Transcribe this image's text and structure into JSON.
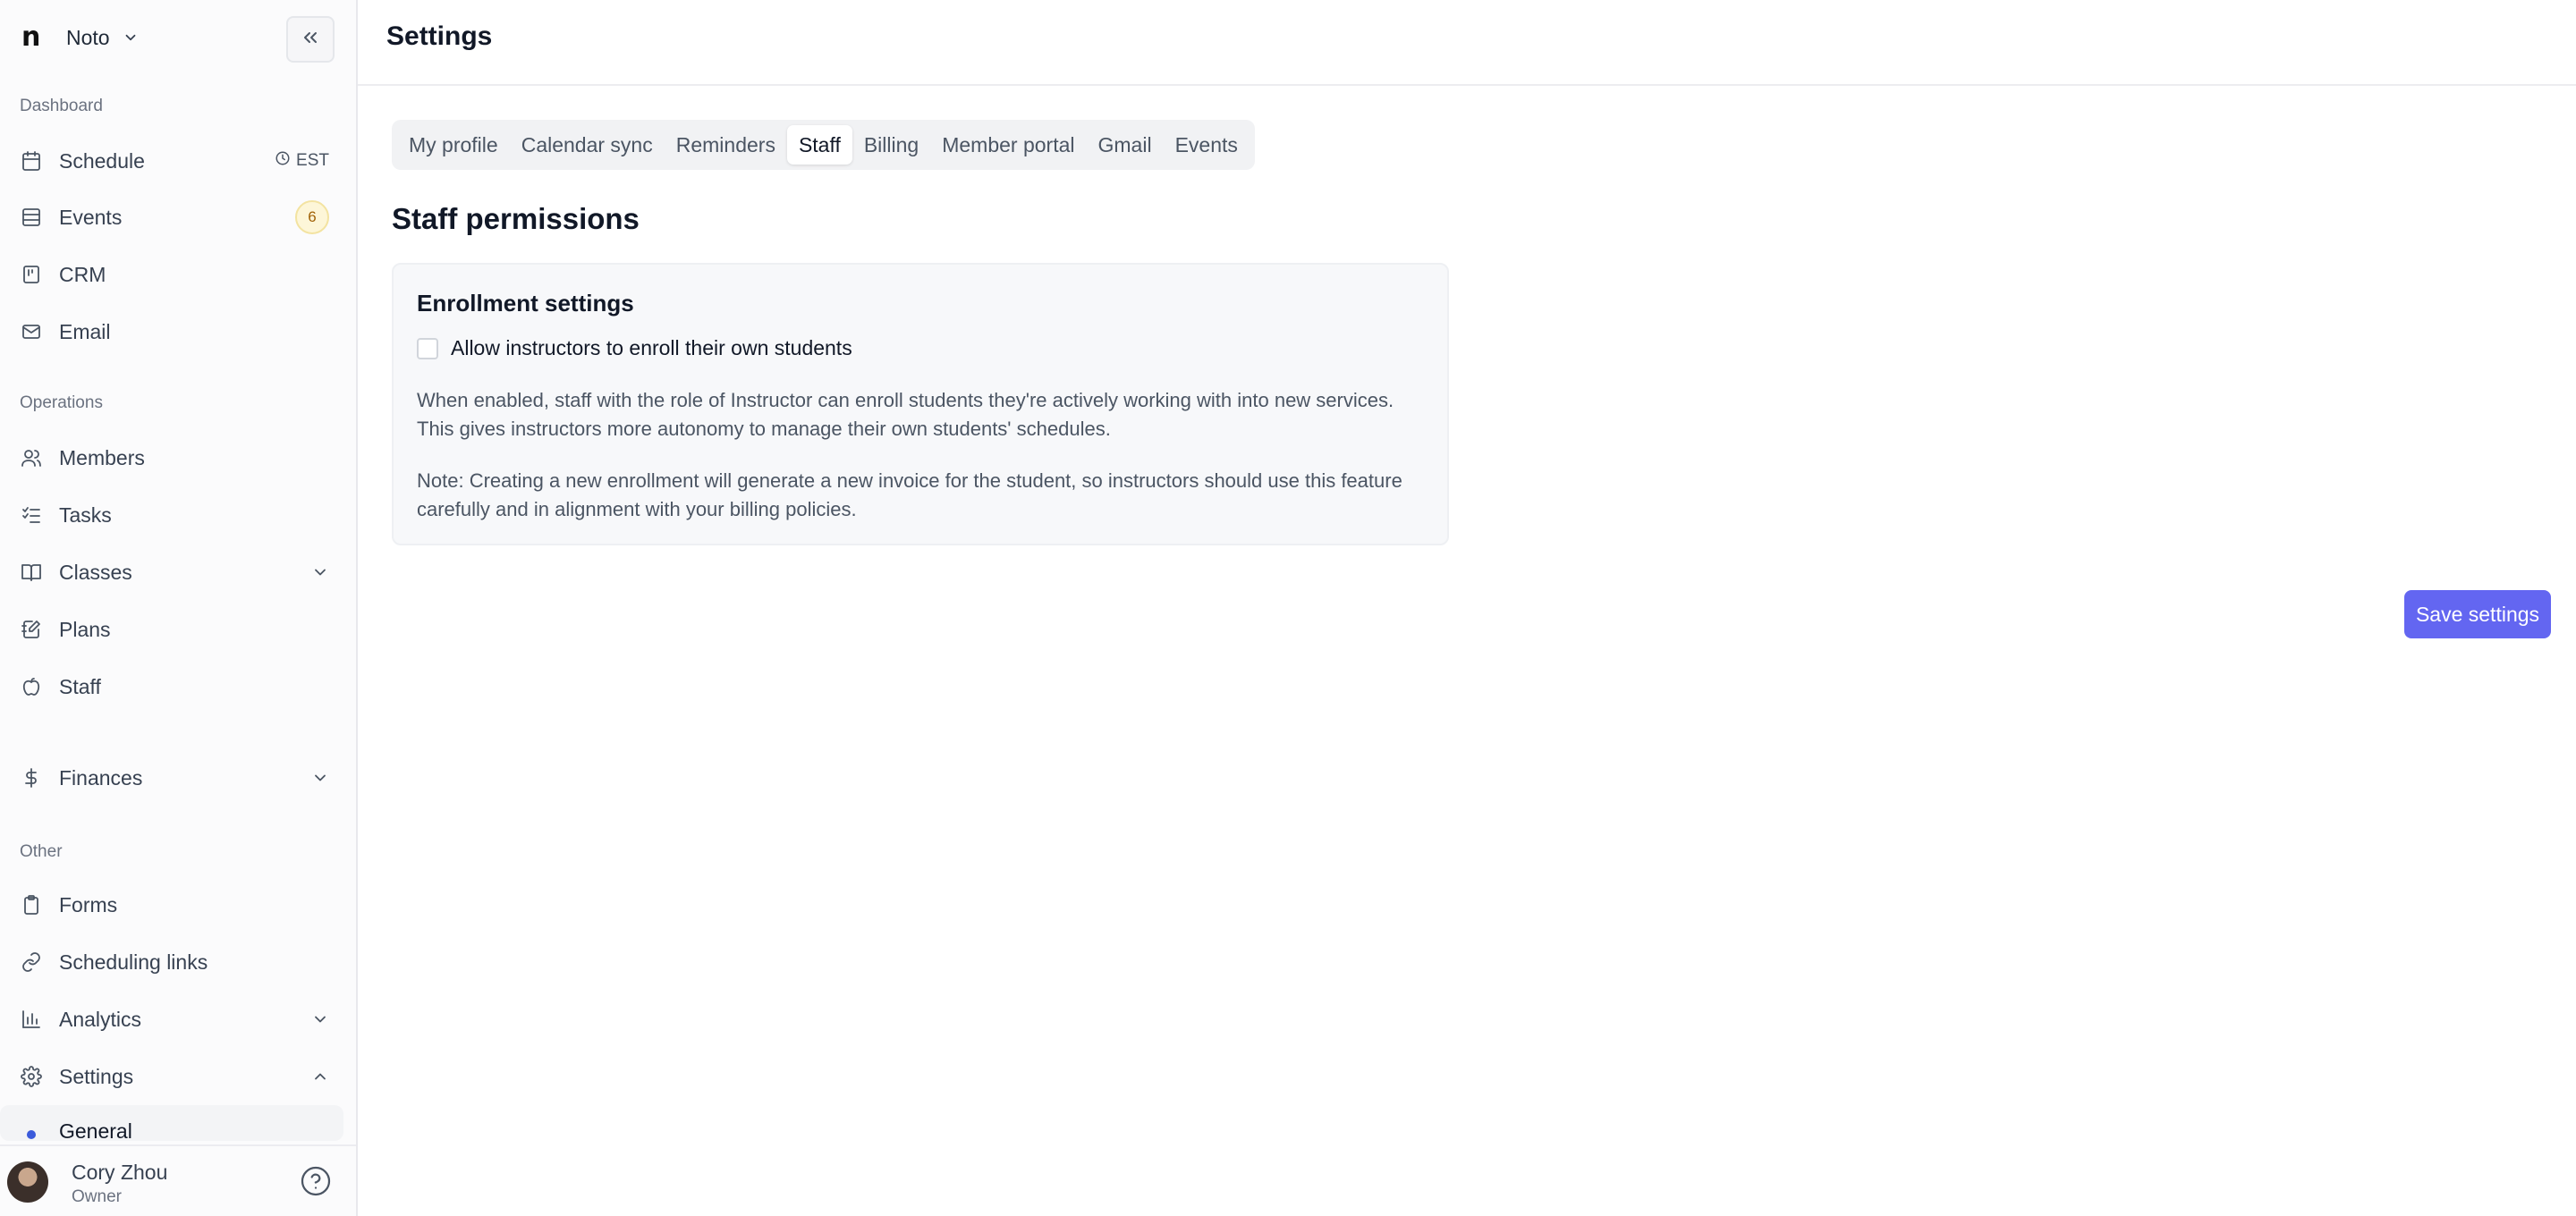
{
  "app": {
    "name": "Noto",
    "logo_text": "n"
  },
  "sidebar": {
    "sections": {
      "dashboard": "Dashboard",
      "operations": "Operations",
      "other": "Other"
    },
    "items": {
      "schedule": {
        "label": "Schedule",
        "timezone": "EST"
      },
      "events": {
        "label": "Events",
        "badge": "6"
      },
      "crm": {
        "label": "CRM"
      },
      "email": {
        "label": "Email"
      },
      "members": {
        "label": "Members"
      },
      "tasks": {
        "label": "Tasks"
      },
      "classes": {
        "label": "Classes"
      },
      "plans": {
        "label": "Plans"
      },
      "staff": {
        "label": "Staff"
      },
      "finances": {
        "label": "Finances"
      },
      "forms": {
        "label": "Forms"
      },
      "scheduling_links": {
        "label": "Scheduling links"
      },
      "analytics": {
        "label": "Analytics"
      },
      "settings": {
        "label": "Settings"
      }
    },
    "settings_subitem": "General",
    "user": {
      "name": "Cory Zhou",
      "role": "Owner"
    }
  },
  "header": {
    "title": "Settings"
  },
  "tabs": [
    {
      "label": "My profile"
    },
    {
      "label": "Calendar sync"
    },
    {
      "label": "Reminders"
    },
    {
      "label": "Staff",
      "active": true
    },
    {
      "label": "Billing"
    },
    {
      "label": "Member portal"
    },
    {
      "label": "Gmail"
    },
    {
      "label": "Events"
    }
  ],
  "main": {
    "section_title": "Staff permissions",
    "card": {
      "title": "Enrollment settings",
      "checkbox_label": "Allow instructors to enroll their own students",
      "checkbox_checked": false,
      "description": "When enabled, staff with the role of Instructor can enroll students they're actively working with into new services. This gives instructors more autonomy to manage their own students' schedules.",
      "note": "Note: Creating a new enrollment will generate a new invoice for the student, so instructors should use this feature carefully and in alignment with your billing policies."
    },
    "save_button": "Save settings"
  },
  "colors": {
    "accent": "#6366f1",
    "badge_bg": "#fdf6d8",
    "badge_text": "#a16207",
    "active_dot": "#3b5bdb"
  }
}
